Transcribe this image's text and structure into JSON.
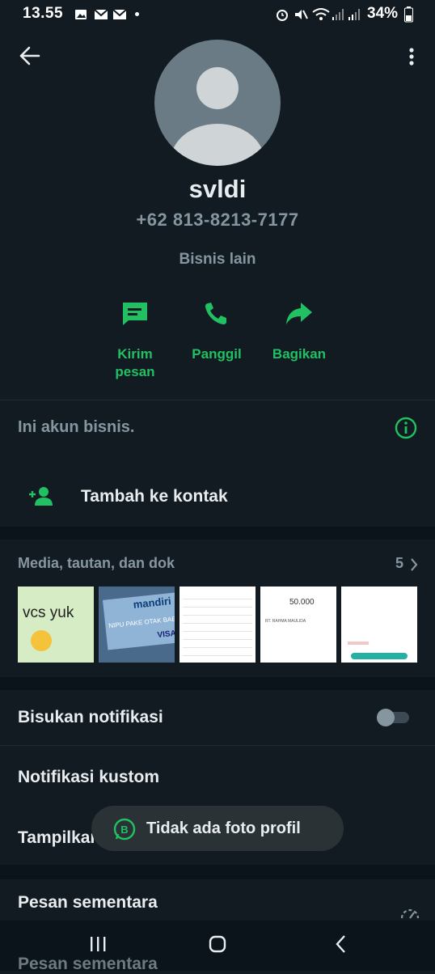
{
  "status": {
    "time": "13.55",
    "battery": "34%"
  },
  "profile": {
    "name": "svldi",
    "phone": "+62 813-8213-7177",
    "category": "Bisnis lain"
  },
  "actions": [
    {
      "label_line1": "Kirim",
      "label_line2": "pesan",
      "icon": "message-icon"
    },
    {
      "label_line1": "Panggil",
      "label_line2": "",
      "icon": "phone-icon"
    },
    {
      "label_line1": "Bagikan",
      "label_line2": "",
      "icon": "share-icon"
    }
  ],
  "business_notice": "Ini akun bisnis.",
  "add_contact": "Tambah ke kontak",
  "media": {
    "title": "Media, tautan, dan dok",
    "count": "5",
    "thumb1_text": "vcs yuk",
    "thumb2_brand": "mandiri",
    "thumb2_text": "NIPU PAKE OTAK BAE",
    "thumb2_card": "VISA",
    "thumb4_amount": "50.000",
    "thumb4_name": "RT. RAHMA MAULIDA"
  },
  "settings": {
    "mute": "Bisukan notifikasi",
    "mute_on": false,
    "custom_notif": "Notifikasi kustom",
    "show_media": "Tampilkan media",
    "temp_msg": "Pesan sementara",
    "temp_msg_partial": "Pesan sementara"
  },
  "toast": "Tidak ada foto profil",
  "colors": {
    "accent": "#21c063",
    "background": "#111b21",
    "muted": "#8696a0"
  }
}
